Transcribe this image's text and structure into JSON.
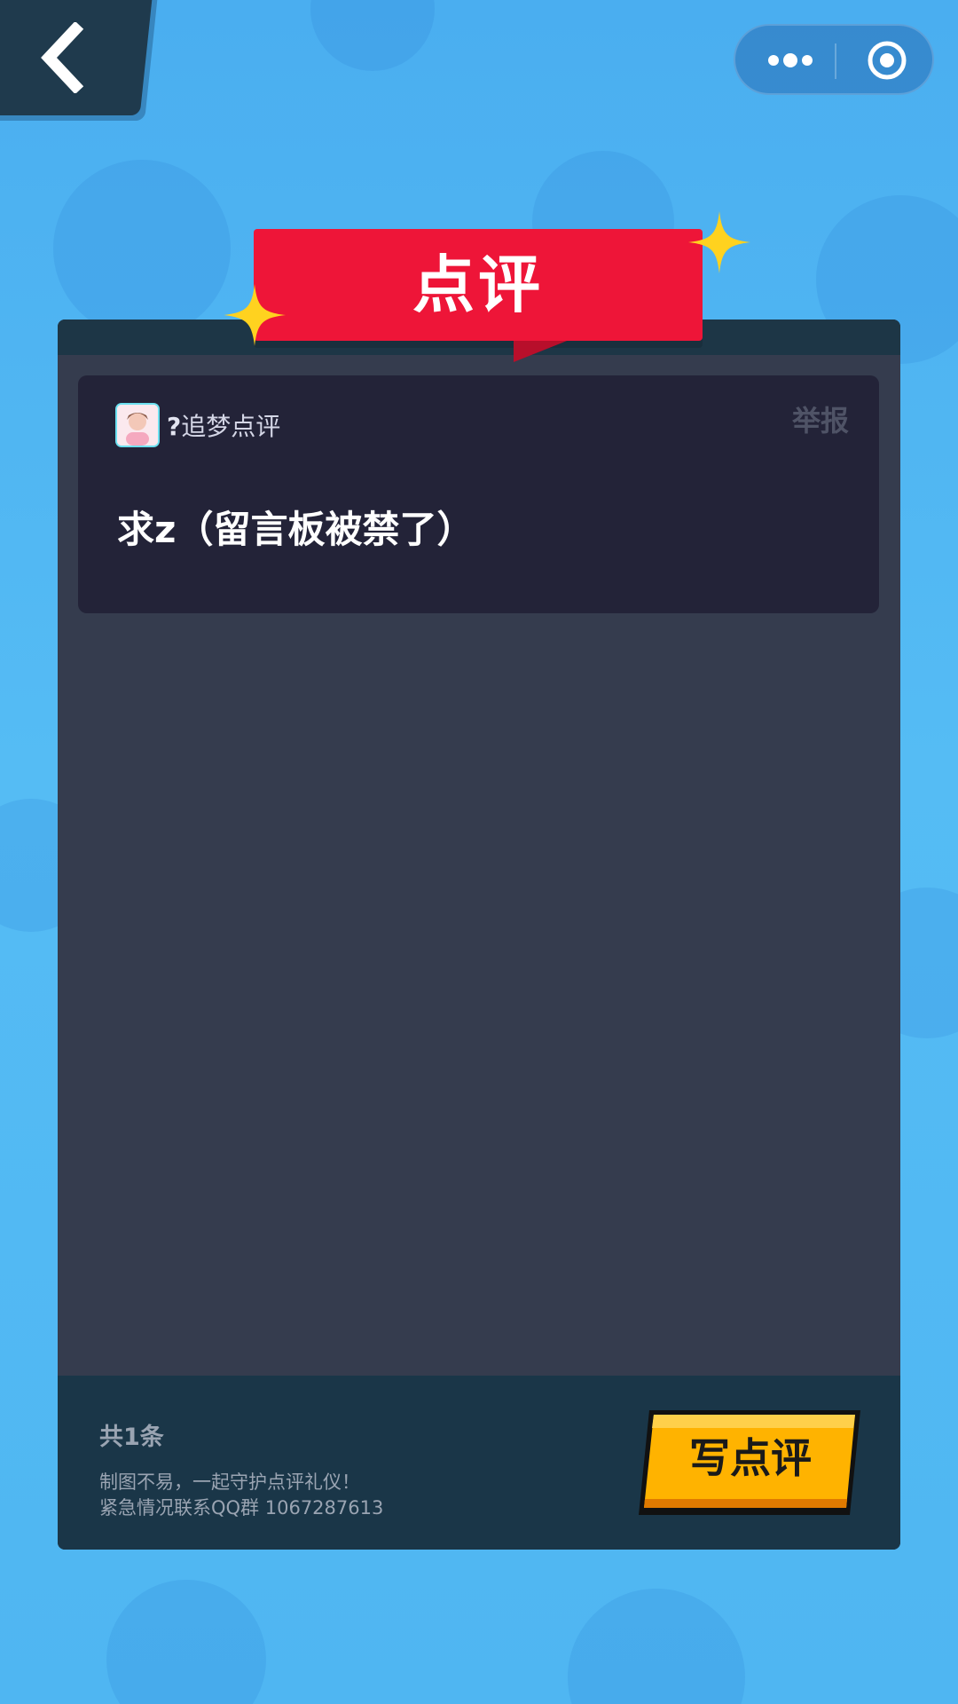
{
  "nav": {
    "back_icon": "chevron-left-icon",
    "capsule_more_icon": "more-dots-icon",
    "capsule_target_icon": "target-circle-icon"
  },
  "ribbon": {
    "title": "点评",
    "color": "#ee1538"
  },
  "reviews": [
    {
      "user_prefix": "?",
      "user_name": "追梦点评",
      "report_label": "举报",
      "content": "求z（留言板被禁了）"
    }
  ],
  "footer": {
    "count_text": "共1条",
    "note_line1": "制图不易，一起守护点评礼仪！",
    "note_line2": "紧急情况联系QQ群 1067287613",
    "write_button_label": "写点评"
  },
  "colors": {
    "background": "#4fb6f2",
    "panel": "#353c4e",
    "card": "#232338",
    "footer": "#1a3648",
    "button": "#ffb300"
  }
}
